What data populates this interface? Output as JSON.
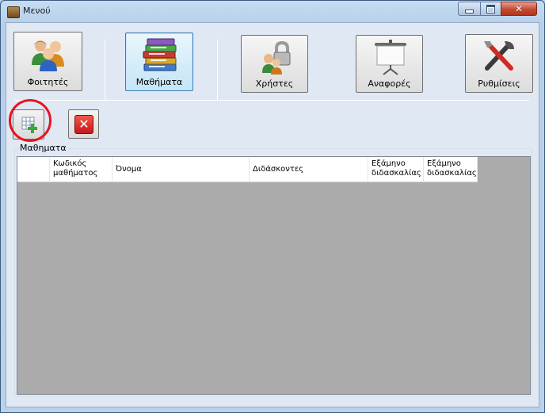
{
  "window": {
    "title": "Μενού",
    "app_icon": "book-icon",
    "controls": {
      "minimize": "minimize-icon",
      "maximize": "maximize-icon",
      "close": "close-icon"
    }
  },
  "nav": {
    "students_label": "Φοιτητές",
    "courses_label": "Μαθήματα",
    "users_label": "Χρήστες",
    "reports_label": "Αναφορές",
    "settings_label": "Ρυθμίσεις",
    "active": "courses"
  },
  "toolbar": {
    "add_icon": "add-row-icon",
    "delete_icon": "delete-icon"
  },
  "group": {
    "label": "Μαθηματα",
    "columns": [
      {
        "line1": "Κωδικός",
        "line2": "μαθήματος"
      },
      {
        "line1": "Όνομα",
        "line2": ""
      },
      {
        "line1": "Διδάσκοντες",
        "line2": ""
      },
      {
        "line1": "Εξάμηνο",
        "line2": "διδασκαλίας"
      },
      {
        "line1": "Εξάμηνο",
        "line2": "διδασκαλίας"
      }
    ]
  },
  "colors": {
    "highlight_circle": "#e8131e",
    "grid_background": "#ababab"
  }
}
